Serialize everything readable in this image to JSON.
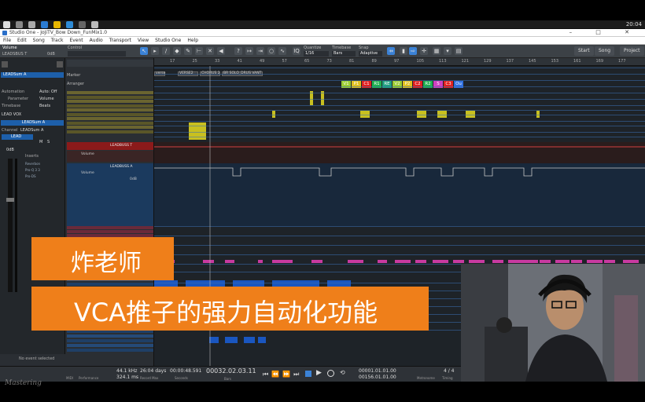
{
  "taskbar": {
    "clock": "20:04"
  },
  "window": {
    "title": "Studio One - JoJiTV_Bow Down_FunMix1.0",
    "controls": "– □ ✕"
  },
  "menu": [
    "File",
    "Edit",
    "Song",
    "Track",
    "Event",
    "Audio",
    "Transport",
    "View",
    "Studio One",
    "Help"
  ],
  "toolbar": {
    "volume_label": "Volume",
    "track_name": "LEADSBUS T",
    "vol_value": "0dB",
    "control_label": "Control",
    "quantize_label": "Quantize",
    "quantize_value": "1/16",
    "timebase_label": "Timebase",
    "timebase_value": "Bars",
    "snap_label": "Snap",
    "snap_value": "Adaptive",
    "start_label": "Start",
    "song_label": "Song",
    "project_label": "Project"
  },
  "inspector": {
    "track_title": "LEADSum A",
    "automation_label": "Automation",
    "automation_value": "Auto: Off",
    "parameter_label": "Parameter",
    "parameter_value": "Volume",
    "timebase_label": "Timebase",
    "timebase_value": "Beats",
    "lead_vox": "LEAD VOX",
    "channel_title": "LEADSum A",
    "channel_label": "Channel",
    "channel_value": "LEADSum A",
    "lead": "LEAD",
    "m": "M",
    "s": "S",
    "db": "0dB",
    "inserts_label": "Inserts",
    "inserts": [
      "Reverbon",
      "Pro-Q 3 3",
      "Pro-DS"
    ],
    "status": "No event selected"
  },
  "tracklist": {
    "marker_label": "Marker",
    "arranger_label": "Arranger",
    "bus_name": "LEADBUSS T",
    "vol_label": "Volume",
    "leadbuss_a": "LEADBUSS A",
    "vol_db": "0dB"
  },
  "ruler": [
    "17",
    "25",
    "33",
    "41",
    "49",
    "57",
    "65",
    "73",
    "81",
    "89",
    "97",
    "105",
    "113",
    "121",
    "129",
    "137",
    "145",
    "153",
    "161",
    "169",
    "177"
  ],
  "markers": [
    "verse",
    "VERSE2",
    "CHORUS 2",
    "BR SOLO_DRUS VANT"
  ],
  "chords": [
    {
      "label": "V1",
      "color": "#9acd32"
    },
    {
      "label": "P1",
      "color": "#e0c020"
    },
    {
      "label": "C1",
      "color": "#e02020"
    },
    {
      "label": "R1",
      "color": "#20b050"
    },
    {
      "label": "RE",
      "color": "#20a080"
    },
    {
      "label": "V2",
      "color": "#9acd32"
    },
    {
      "label": "P2",
      "color": "#e0c020"
    },
    {
      "label": "C2",
      "color": "#e02020"
    },
    {
      "label": "R2",
      "color": "#20b050"
    },
    {
      "label": "S",
      "color": "#d040c0"
    },
    {
      "label": "C3",
      "color": "#e02020"
    },
    {
      "label": "Ou",
      "color": "#3070e0"
    }
  ],
  "transport": {
    "sample_rate": "44.1 kHz",
    "latency": "324.1 ms",
    "record_days": "26:04 days",
    "record_max": "Record Max",
    "seconds": "00:00:48.591",
    "seconds_label": "Seconds",
    "position": "00032.02.03.11",
    "bars_label": "Bars",
    "loop_start": "00001.01.01.00",
    "loop_end": "00156.01.01.00",
    "metronome_label": "Metronome",
    "timing_label": "Timing",
    "sig": "4 / 4",
    "midi_label": "MIDI",
    "performance_label": "Performance"
  },
  "overlay": {
    "name": "炸老师",
    "title": "VCA推子的强力自动化功能"
  },
  "watermark": "Mastering"
}
